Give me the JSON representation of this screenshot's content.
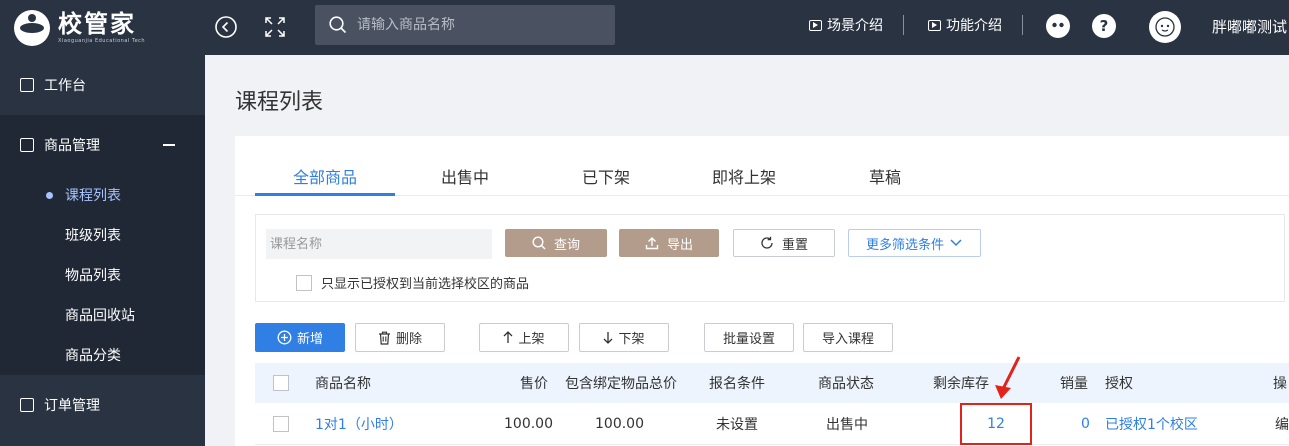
{
  "app": {
    "logo_cn": "校管家",
    "logo_en": "Xiaoguanjia Educational Tech",
    "search_placeholder": "请输入商品名称",
    "links": [
      "场景介绍",
      "功能介绍"
    ],
    "username": "胖嘟嘟测试"
  },
  "sidebar": {
    "items": [
      {
        "label": "工作台",
        "icon": "monitor-icon"
      },
      {
        "label": "商品管理",
        "icon": "bag-icon"
      },
      {
        "label": "订单管理",
        "icon": "document-icon"
      }
    ],
    "subitems": [
      "课程列表",
      "班级列表",
      "物品列表",
      "商品回收站",
      "商品分类"
    ]
  },
  "page": {
    "title": "课程列表",
    "tabs": [
      "全部商品",
      "出售中",
      "已下架",
      "即将上架",
      "草稿"
    ],
    "filter": {
      "placeholder": "课程名称",
      "query": "查询",
      "export": "导出",
      "reset": "重置",
      "more": "更多筛选条件",
      "checkbox_label": "只显示已授权到当前选择校区的商品"
    },
    "actions": [
      "新增",
      "删除",
      "上架",
      "下架",
      "批量设置",
      "导入课程"
    ],
    "table": {
      "columns": [
        "商品名称",
        "售价",
        "包含绑定物品总价",
        "报名条件",
        "商品状态",
        "剩余库存",
        "销量",
        "授权",
        "操"
      ],
      "rows": [
        {
          "name": "1对1（小时）",
          "price": "100.00",
          "bundle_price": "100.00",
          "condition": "未设置",
          "status": "出售中",
          "stock": "12",
          "sales": "0",
          "auth": "已授权1个校区",
          "op": "编"
        }
      ]
    }
  },
  "colors": {
    "accent": "#2f7fe5",
    "sidebar": "#2a3342",
    "highlight": "#e2231a"
  }
}
